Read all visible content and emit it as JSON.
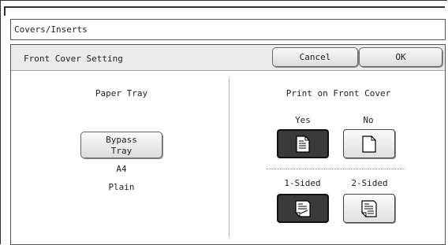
{
  "header": {
    "title": "Covers/Inserts"
  },
  "panel": {
    "title": "Front Cover Setting",
    "cancel_label": "Cancel",
    "ok_label": "OK"
  },
  "paper_tray": {
    "label": "Paper Tray",
    "button_line1": "Bypass",
    "button_line2": "Tray",
    "size": "A4",
    "type": "Plain"
  },
  "print_on_cover": {
    "label": "Print on Front Cover",
    "yes_label": "Yes",
    "no_label": "No",
    "selected": "Yes"
  },
  "sides": {
    "one_sided_label": "1-Sided",
    "two_sided_label": "2-Sided",
    "selected": "1-Sided"
  },
  "icons": {
    "yes": "printed-page-icon",
    "no": "blank-page-icon",
    "one_sided": "one-sided-page-icon",
    "two_sided": "two-sided-page-icon"
  }
}
